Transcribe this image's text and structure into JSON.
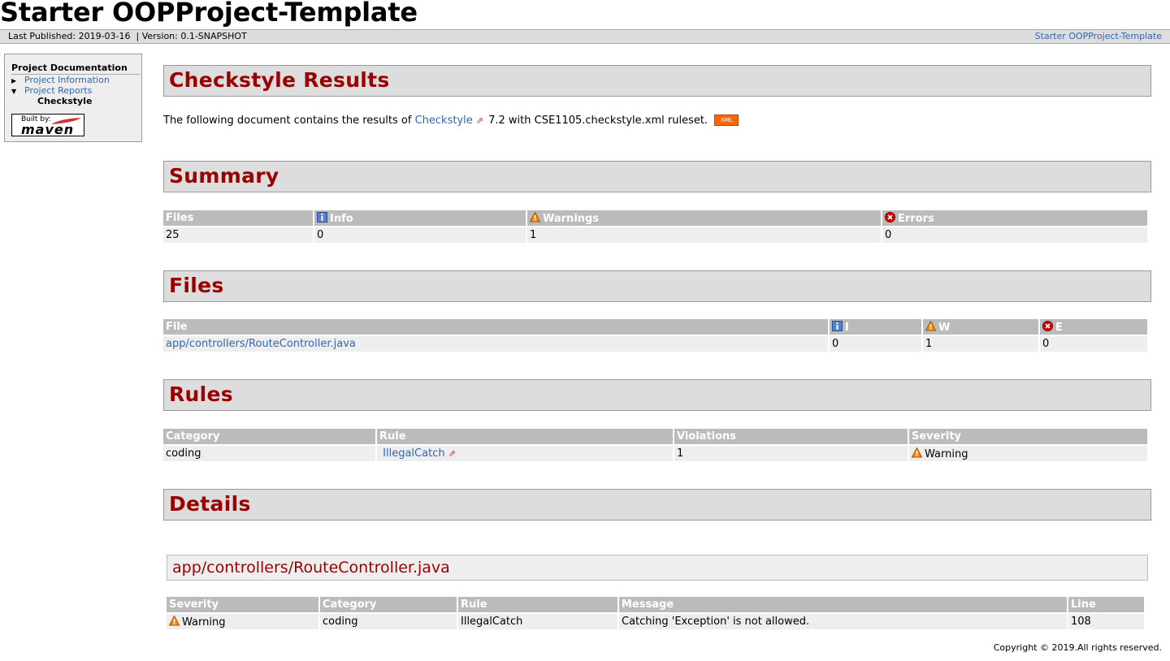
{
  "banner": {
    "title": "Starter OOPProject-Template"
  },
  "breadcrumbs": {
    "left": "Last Published: 2019-03-16  | Version: 0.1-SNAPSHOT",
    "right": "Starter OOPProject-Template"
  },
  "nav": {
    "heading": "Project Documentation",
    "items": [
      {
        "label": "Project Information",
        "icon": "triangle-right-icon"
      },
      {
        "label": "Project Reports",
        "icon": "triangle-down-icon"
      }
    ],
    "sub_item": "Checkstyle",
    "maven_badge": {
      "built_by": "Built by:",
      "name": "maven"
    }
  },
  "sections": {
    "checkstyle_results": "Checkstyle Results",
    "summary": "Summary",
    "files": "Files",
    "rules": "Rules",
    "details": "Details"
  },
  "intro": {
    "prefix": "The following document contains the results of ",
    "link": "Checkstyle",
    "suffix": " 7.2 with CSE1105.checkstyle.xml ruleset.",
    "xml_badge": "XML"
  },
  "summary_table": {
    "headers": [
      "Files",
      "Info",
      "Warnings",
      "Errors"
    ],
    "row": [
      "25",
      "0",
      "1",
      "0"
    ]
  },
  "files_table": {
    "headers": [
      "File",
      "I",
      "W",
      "E"
    ],
    "row": [
      "app/controllers/RouteController.java",
      "0",
      "1",
      "0"
    ]
  },
  "rules_table": {
    "headers": [
      "Category",
      "Rule",
      "Violations",
      "Severity"
    ],
    "row": [
      "coding",
      "IllegalCatch",
      "1",
      "Warning"
    ]
  },
  "details_file": "app/controllers/RouteController.java",
  "details_table": {
    "headers": [
      "Severity",
      "Category",
      "Rule",
      "Message",
      "Line"
    ],
    "row": [
      "Warning",
      "coding",
      "IllegalCatch",
      "Catching 'Exception' is not allowed.",
      "108"
    ]
  },
  "footer": "Copyright © 2019.All rights reserved.",
  "colors": {
    "heading": "#990000",
    "link": "#3366aa",
    "header_bg": "#dddddd",
    "th_bg": "#bbbbbb",
    "xml_badge": "#ff6600"
  }
}
